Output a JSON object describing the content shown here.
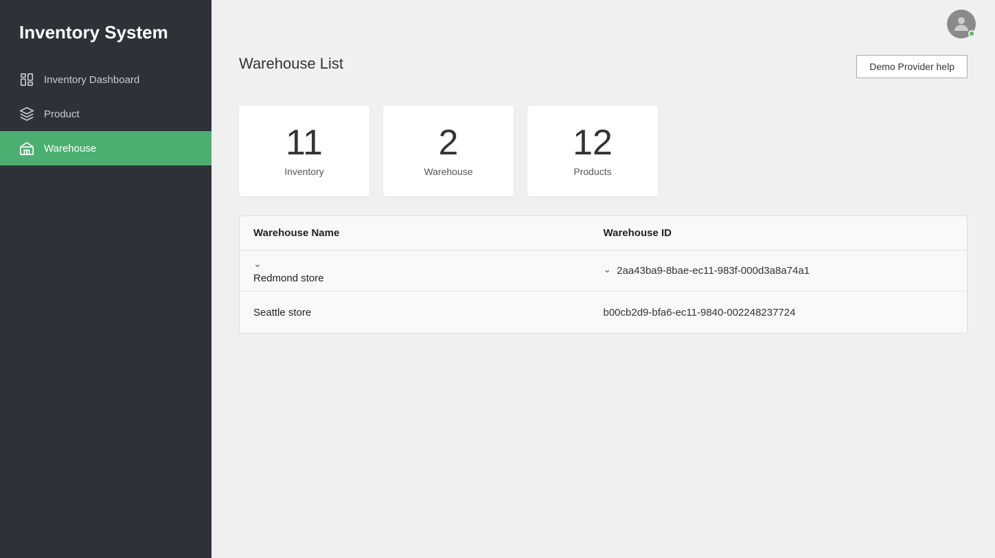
{
  "app": {
    "title": "Inventory System"
  },
  "sidebar": {
    "items": [
      {
        "id": "inventory-dashboard",
        "label": "Inventory Dashboard",
        "icon": "dashboard-icon",
        "active": false
      },
      {
        "id": "product",
        "label": "Product",
        "icon": "product-icon",
        "active": false
      },
      {
        "id": "warehouse",
        "label": "Warehouse",
        "icon": "warehouse-icon",
        "active": true
      }
    ]
  },
  "header": {
    "demo_help_label": "Demo Provider help"
  },
  "page": {
    "title": "Warehouse List"
  },
  "stats": [
    {
      "number": "11",
      "label": "Inventory"
    },
    {
      "number": "2",
      "label": "Warehouse"
    },
    {
      "number": "12",
      "label": "Products"
    }
  ],
  "table": {
    "columns": [
      {
        "label": "Warehouse Name"
      },
      {
        "label": "Warehouse ID"
      }
    ],
    "rows": [
      {
        "name": "Redmond store",
        "id": "2aa43ba9-8bae-ec11-983f-000d3a8a74a1"
      },
      {
        "name": "Seattle store",
        "id": "b00cb2d9-bfa6-ec11-9840-002248237724"
      }
    ]
  }
}
